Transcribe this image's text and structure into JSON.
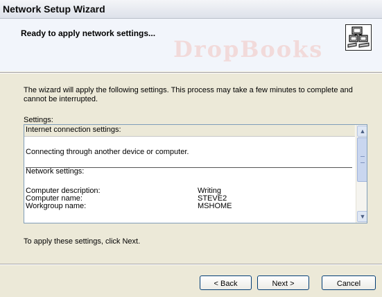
{
  "window": {
    "title": "Network Setup Wizard"
  },
  "header": {
    "heading": "Ready to apply network settings...",
    "icon": "network-computers-icon"
  },
  "watermark": {
    "text": "DropBooks"
  },
  "body": {
    "description": "The wizard will apply the following settings. This process may take a few minutes to complete and cannot be interrupted.",
    "settings_label": "Settings:",
    "apply_text": "To apply these settings, click Next."
  },
  "settings_list": {
    "internet_header": "Internet connection settings:",
    "internet_value": "Connecting through another device or computer.",
    "network_header": "Network settings:",
    "items": [
      {
        "label": "Computer description:",
        "value": "Writing"
      },
      {
        "label": "Computer name:",
        "value": "STEVE2"
      },
      {
        "label": "Workgroup name:",
        "value": "MSHOME"
      }
    ]
  },
  "scrollbar": {
    "up": "▲",
    "down": "▼"
  },
  "buttons": {
    "back": "< Back",
    "next": "Next >",
    "cancel": "Cancel"
  }
}
